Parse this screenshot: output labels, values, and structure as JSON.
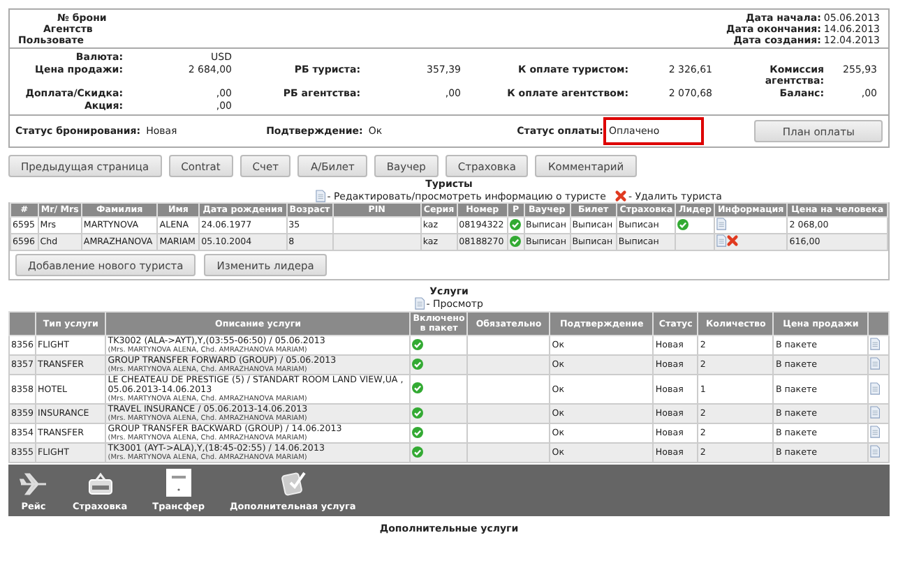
{
  "booking": {
    "left": [
      "№ брони",
      "Агентств",
      "Пользовате"
    ],
    "right": [
      {
        "label": "Дата начала:",
        "value": "05.06.2013"
      },
      {
        "label": "Дата окончания:",
        "value": "14.06.2013"
      },
      {
        "label": "Дата создания:",
        "value": "12.04.2013"
      }
    ]
  },
  "finance": [
    [
      {
        "label": "Валюта:",
        "value": "USD"
      }
    ],
    [
      {
        "label": "Цена продажи:",
        "value": "2 684,00"
      },
      {
        "label": "РБ туриста:",
        "value": "357,39"
      },
      {
        "label": "К оплате туристом:",
        "value": "2 326,61"
      },
      {
        "label": "Комиссия агентства:",
        "value": "255,93"
      }
    ],
    [
      {
        "label": "Доплата/Скидка:",
        "value": ",00"
      },
      {
        "label": "РБ агентства:",
        "value": ",00"
      },
      {
        "label": "К оплате агентством:",
        "value": "2 070,68"
      },
      {
        "label": "Баланс:",
        "value": ",00"
      }
    ],
    [
      {
        "label": "Акция:",
        "value": ",00"
      }
    ]
  ],
  "statuses": [
    {
      "label": "Статус бронирования:",
      "value": "Новая",
      "highlighted": false
    },
    {
      "label": "Подтверждение:",
      "value": "Ок",
      "highlighted": false
    },
    {
      "label": "Статус оплаты:",
      "value": "Оплачено",
      "highlighted": true
    }
  ],
  "payment_plan_button": "План оплаты",
  "actions": [
    "Предыдущая страница",
    "Contrat",
    "Счет",
    "А/Билет",
    "Ваучер",
    "Страховка",
    "Комментарий"
  ],
  "tourists": {
    "title": "Туристы",
    "legend_edit": "- Редактировать/просмотреть информацию о туристе",
    "legend_delete": "- Удалить туриста",
    "columns": [
      "#",
      "Mr/ Mrs",
      "Фамилия",
      "Имя",
      "Дата рождения",
      "Возраст",
      "PIN",
      "Серия",
      "Номер",
      "P",
      "Ваучер",
      "Билет",
      "Страховка",
      "Лидер",
      "Информация",
      "Цена на человека"
    ],
    "rows": [
      {
        "id": "6595",
        "title": "Mrs",
        "surname": "MARTYNOVA",
        "name": "ALENA",
        "birth": "24.06.1977",
        "age": "35",
        "series": "kaz",
        "number": "08194322",
        "p": true,
        "voucher": "Выписан",
        "ticket": "Выписан",
        "insurance": "Выписан",
        "leader": true,
        "deletable": false,
        "price": "2 068,00"
      },
      {
        "id": "6596",
        "title": "Chd",
        "surname": "AMRAZHANOVA",
        "name": "MARIAM",
        "birth": "05.10.2004",
        "age": "8",
        "series": "kaz",
        "number": "08188270",
        "p": true,
        "voucher": "Выписан",
        "ticket": "Выписан",
        "insurance": "Выписан",
        "leader": false,
        "deletable": true,
        "price": "616,00"
      }
    ],
    "buttons": [
      "Добавление нового туриста",
      "Изменить лидера"
    ]
  },
  "services": {
    "title": "Услуги",
    "legend_view": "- Просмотр",
    "columns": [
      "Тип услуги",
      "Описание услуги",
      "Включено в пакет",
      "Обязательно",
      "Подтверждение",
      "Статус",
      "Количество",
      "Цена продажи"
    ],
    "rows": [
      {
        "id": "8356",
        "type": "FLIGHT",
        "description": "TK3002 (ALA->AYT),Y,(03:55-06:50) / 05.06.2013",
        "tourists": "(Mrs. MARTYNOVA ALENA, Chd. AMRAZHANOVA MARIAM)",
        "included": true,
        "confirmation": "Ок",
        "status": "Новая",
        "quantity": "2",
        "price": "В пакете"
      },
      {
        "id": "8357",
        "type": "TRANSFER",
        "description": "GROUP TRANSFER FORWARD (GROUP) / 05.06.2013",
        "tourists": "(Mrs. MARTYNOVA ALENA, Chd. AMRAZHANOVA MARIAM)",
        "included": true,
        "confirmation": "Ок",
        "status": "Новая",
        "quantity": "2",
        "price": "В пакете"
      },
      {
        "id": "8358",
        "type": "HOTEL",
        "description": "LE CHEATEAU DE PRESTIGE (5) / STANDART ROOM LAND VIEW,UA , 05.06.2013-14.06.2013",
        "tourists": "(Mrs. MARTYNOVA ALENA, Chd. AMRAZHANOVA MARIAM)",
        "included": true,
        "confirmation": "Ок",
        "status": "Новая",
        "quantity": "1",
        "price": "В пакете"
      },
      {
        "id": "8359",
        "type": "INSURANCE",
        "description": "TRAVEL INSURANCE / 05.06.2013-14.06.2013",
        "tourists": "(Mrs. MARTYNOVA ALENA, Chd. AMRAZHANOVA MARIAM)",
        "included": true,
        "confirmation": "Ок",
        "status": "Новая",
        "quantity": "2",
        "price": "В пакете"
      },
      {
        "id": "8354",
        "type": "TRANSFER",
        "description": "GROUP TRANSFER BACKWARD (GROUP) / 14.06.2013",
        "tourists": "(Mrs. MARTYNOVA ALENA, Chd. AMRAZHANOVA MARIAM)",
        "included": true,
        "confirmation": "Ок",
        "status": "Новая",
        "quantity": "2",
        "price": "В пакете"
      },
      {
        "id": "8355",
        "type": "FLIGHT",
        "description": "TK3001 (AYT->ALA),Y,(18:45-02:55) / 14.06.2013",
        "tourists": "(Mrs. MARTYNOVA ALENA, Chd. AMRAZHANOVA MARIAM)",
        "included": true,
        "confirmation": "Ок",
        "status": "Новая",
        "quantity": "2",
        "price": "В пакете"
      }
    ]
  },
  "add_toolbar": [
    {
      "kind": "flight",
      "label": "Рейс"
    },
    {
      "kind": "insurance",
      "label": "Страховка"
    },
    {
      "kind": "transfer",
      "label": "Трансфер"
    },
    {
      "kind": "extra",
      "label": "Дополнительная услуга"
    }
  ],
  "extra_services_title": "Дополнительные услуги"
}
